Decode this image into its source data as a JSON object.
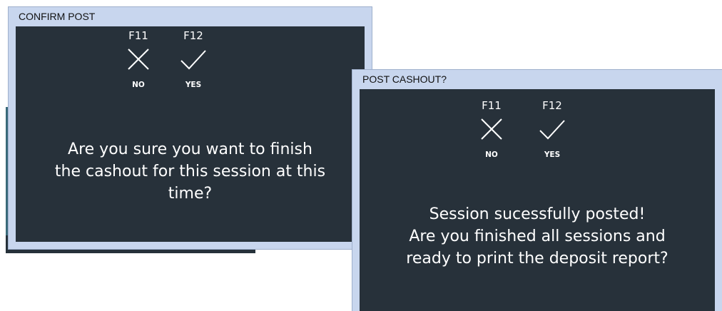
{
  "dialog1": {
    "title": "CONFIRM POST",
    "no": {
      "key": "F11",
      "label": "NO",
      "icon": "x-icon"
    },
    "yes": {
      "key": "F12",
      "label": "YES",
      "icon": "check-icon"
    },
    "message_lines": [
      "Are you sure you want to finish",
      "the cashout for this session at this",
      "time?"
    ]
  },
  "dialog2": {
    "title": "POST CASHOUT?",
    "no": {
      "key": "F11",
      "label": "NO",
      "icon": "x-icon"
    },
    "yes": {
      "key": "F12",
      "label": "YES",
      "icon": "check-icon"
    },
    "message_lines": [
      "Session sucessfully posted!",
      "Are you finished all sessions and",
      "ready to print the deposit report?"
    ]
  },
  "colors": {
    "titlebar": "#c8d6ee",
    "body": "#27313a",
    "text": "#ffffff"
  }
}
